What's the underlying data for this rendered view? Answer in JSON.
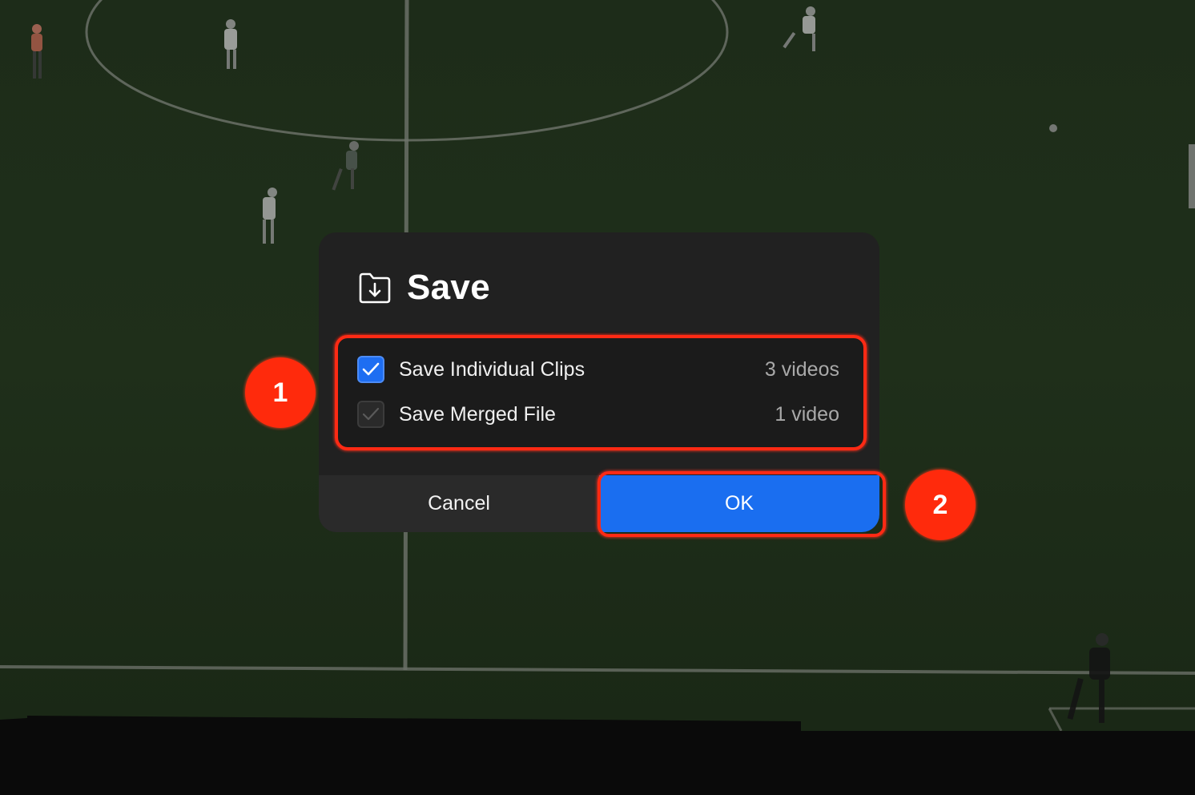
{
  "dialog": {
    "title": "Save",
    "title_icon": "folder-download-icon",
    "options": [
      {
        "label": "Save Individual Clips",
        "count": "3 videos",
        "checked": true
      },
      {
        "label": "Save Merged File",
        "count": "1 video",
        "checked": false
      }
    ],
    "cancel_label": "Cancel",
    "ok_label": "OK"
  },
  "annotations": {
    "badge_1": "1",
    "badge_2": "2"
  },
  "colors": {
    "accent": "#1a6ef0",
    "annotation": "#ff2a14",
    "dialog_bg": "#212121",
    "pitch": "#1b2a17"
  }
}
